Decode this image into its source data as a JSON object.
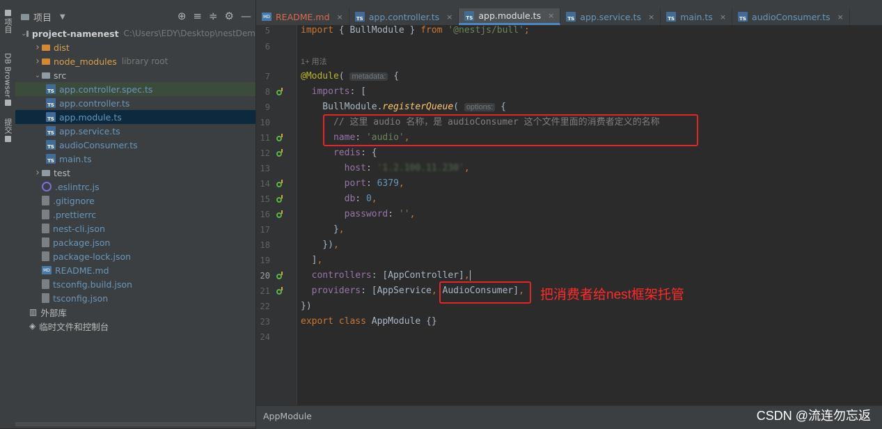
{
  "toolstrip": {
    "project_label": "项目",
    "db_label": "DB Browser",
    "commit_label": "提交"
  },
  "project_panel": {
    "title": "项目",
    "tools": [
      "⊕",
      "≡",
      "≑",
      "⚙",
      "—"
    ],
    "tree": [
      {
        "indent": 0,
        "arrow": "open",
        "icon": "folder",
        "name": "project-namenest",
        "bold": true,
        "extra": "C:\\Users\\EDY\\Desktop\\nestDem"
      },
      {
        "indent": 1,
        "arrow": "closed",
        "icon": "folder-orange",
        "name": "dist",
        "color": "orange"
      },
      {
        "indent": 1,
        "arrow": "closed",
        "icon": "folder-orange",
        "name": "node_modules",
        "color": "orange",
        "extra": "library root"
      },
      {
        "indent": 1,
        "arrow": "open",
        "icon": "folder",
        "name": "src"
      },
      {
        "indent": 2,
        "icon": "ts",
        "name": "app.controller.spec.ts",
        "color": "ts",
        "state": "hl"
      },
      {
        "indent": 2,
        "icon": "ts",
        "name": "app.controller.ts",
        "color": "ts"
      },
      {
        "indent": 2,
        "icon": "ts",
        "name": "app.module.ts",
        "color": "ts",
        "state": "sel"
      },
      {
        "indent": 2,
        "icon": "ts",
        "name": "app.service.ts",
        "color": "ts"
      },
      {
        "indent": 2,
        "icon": "ts",
        "name": "audioConsumer.ts",
        "color": "ts"
      },
      {
        "indent": 2,
        "icon": "ts",
        "name": "main.ts",
        "color": "ts"
      },
      {
        "indent": 1,
        "arrow": "closed",
        "icon": "folder",
        "name": "test"
      },
      {
        "indent": 1,
        "icon": "circle",
        "name": ".eslintrc.js",
        "color": "ts"
      },
      {
        "indent": 1,
        "icon": "file",
        "name": ".gitignore",
        "color": "ts"
      },
      {
        "indent": 1,
        "icon": "file",
        "name": ".prettierrc",
        "color": "ts"
      },
      {
        "indent": 1,
        "icon": "file",
        "name": "nest-cli.json",
        "color": "ts"
      },
      {
        "indent": 1,
        "icon": "file",
        "name": "package.json",
        "color": "ts"
      },
      {
        "indent": 1,
        "icon": "file",
        "name": "package-lock.json",
        "color": "ts"
      },
      {
        "indent": 1,
        "icon": "md",
        "name": "README.md",
        "color": "ts"
      },
      {
        "indent": 1,
        "icon": "file",
        "name": "tsconfig.build.json",
        "color": "ts"
      },
      {
        "indent": 1,
        "icon": "file",
        "name": "tsconfig.json",
        "color": "ts"
      },
      {
        "indent": 0,
        "icon": "lib",
        "name": "外部库"
      },
      {
        "indent": 0,
        "icon": "scratch",
        "name": "临时文件和控制台"
      }
    ]
  },
  "tabs": [
    {
      "label": "README.md",
      "type": "md"
    },
    {
      "label": "app.controller.ts",
      "type": "ts"
    },
    {
      "label": "app.module.ts",
      "type": "ts",
      "active": true
    },
    {
      "label": "app.service.ts",
      "type": "ts"
    },
    {
      "label": "main.ts",
      "type": "ts"
    },
    {
      "label": "audioConsumer.ts",
      "type": "ts"
    }
  ],
  "editor": {
    "line_numbers": [
      "5",
      "6",
      "",
      "7",
      "8",
      "9",
      "10",
      "11",
      "12",
      "13",
      "14",
      "15",
      "16",
      "17",
      "18",
      "19",
      "20",
      "21",
      "22",
      "23",
      "24"
    ],
    "current_line": "20",
    "gutter_marks": [
      "8",
      "11",
      "12",
      "14",
      "15",
      "16",
      "20",
      "21"
    ],
    "usage_hint": "1+ 用法",
    "metadata_hint": "metadata:",
    "options_hint": "options:",
    "comment": "// 这里 audio 名称，是 audioConsumer 这个文件里面的消费者定义的名称",
    "queue_name": "'audio'",
    "import_source": "'@nestjs/bull'",
    "redis_host": "'1.2.100.11.230'",
    "redis_port": "6379",
    "redis_db": "0",
    "redis_password": "''"
  },
  "annotation": {
    "text": "把消费者给nest框架托管",
    "color": "#ff2a2a"
  },
  "status": {
    "breadcrumb": "AppModule"
  },
  "watermark": "CSDN @流连勿忘返"
}
